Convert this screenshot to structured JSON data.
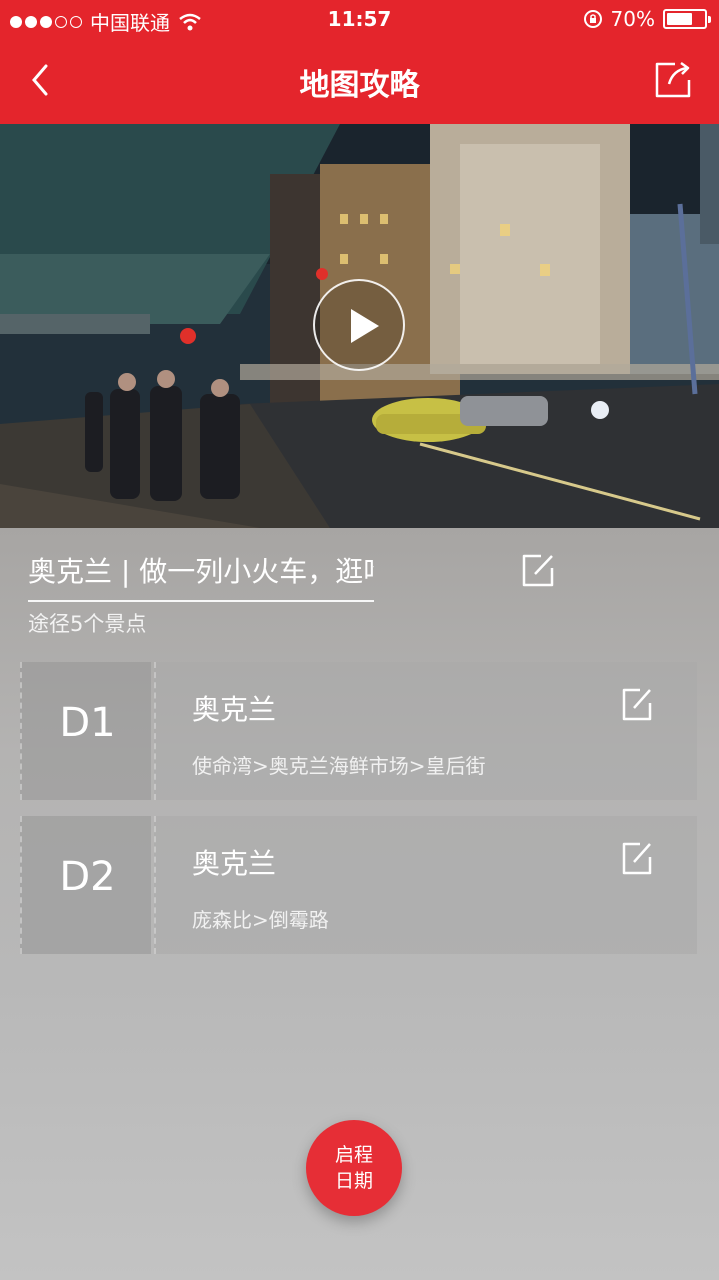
{
  "status_bar": {
    "carrier": "中国联通",
    "time": "11:57",
    "battery_pct": "70%",
    "battery_level": 0.7
  },
  "header": {
    "title": "地图攻略",
    "back_icon": "chevron-left-icon",
    "share_icon": "share-icon"
  },
  "video": {
    "play_icon": "play-icon"
  },
  "trip": {
    "title": "奥克兰 | 做一列小火车，逛吃逛吃",
    "subtitle": "途径5个景点"
  },
  "days": [
    {
      "label": "D1",
      "city": "奥克兰",
      "route": "使命湾>奥克兰海鲜市场>皇后街"
    },
    {
      "label": "D2",
      "city": "奥克兰",
      "route": "庞森比>倒霉路"
    }
  ],
  "fab": {
    "line1": "启程",
    "line2": "日期"
  },
  "colors": {
    "brand_red": "#e4252c"
  }
}
